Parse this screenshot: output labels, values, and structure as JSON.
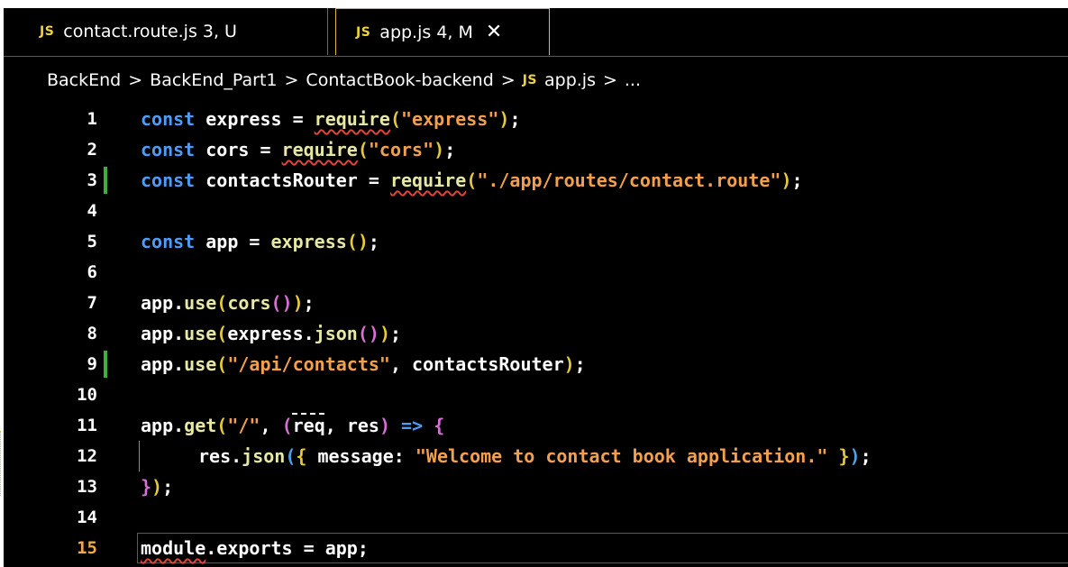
{
  "tabs": [
    {
      "badge": "JS",
      "label": "contact.route.js 3, U",
      "active": false
    },
    {
      "badge": "JS",
      "label": "app.js 4, M",
      "active": true,
      "close_icon": "close-icon"
    }
  ],
  "breadcrumb": {
    "parts": [
      "BackEnd",
      "BackEnd_Part1",
      "ContactBook-backend"
    ],
    "separator": ">",
    "file_badge": "JS",
    "file": "app.js",
    "trail": "..."
  },
  "lines": [
    "1",
    "2",
    "3",
    "4",
    "5",
    "6",
    "7",
    "8",
    "9",
    "10",
    "11",
    "12",
    "13",
    "14",
    "15"
  ],
  "code": {
    "l1": {
      "kw": "const",
      "a": " express = ",
      "req": "require",
      "p1": "(",
      "s": "\"express\"",
      "p2": ")",
      "end": ";"
    },
    "l2": {
      "kw": "const",
      "a": " cors = ",
      "req": "require",
      "p1": "(",
      "s": "\"cors\"",
      "p2": ")",
      "end": ";"
    },
    "l3": {
      "kw": "const",
      "a": " contactsRouter = ",
      "req": "require",
      "p1": "(",
      "s": "\"./app/routes/contact.route\"",
      "p2": ")",
      "end": ";"
    },
    "l5": {
      "kw": "const",
      "a": " app = ",
      "fn": "express",
      "p": "()",
      "end": ";"
    },
    "l7": {
      "a": "app.",
      "fn": "use",
      "p1": "(",
      "b": "cors",
      "p2": "()",
      "p3": ")",
      "end": ";"
    },
    "l8": {
      "a": "app.",
      "fn": "use",
      "p1": "(",
      "b": "express.",
      "c": "json",
      "p2": "()",
      "p3": ")",
      "end": ";"
    },
    "l9": {
      "a": "app.",
      "fn": "use",
      "p1": "(",
      "s": "\"/api/contacts\"",
      "b": ", contactsRouter",
      "p2": ")",
      "end": ";"
    },
    "l11": {
      "a": "app.",
      "fn": "get",
      "p1": "(",
      "s": "\"/\"",
      "b": ", ",
      "p2": "(",
      "c": "req",
      "d": ", res",
      "p3": ")",
      "e": " ",
      "arrow": "=>",
      "f": " ",
      "p4": "{"
    },
    "l12": {
      "a": "res.",
      "fn": "json",
      "p1": "(",
      "p2": "{",
      "b": " message: ",
      "s": "\"Welcome to contact book application.\"",
      "c": " ",
      "p3": "}",
      "p4": ")",
      "end": ";"
    },
    "l13": {
      "p1": "}",
      "p2": ")",
      "end": ";"
    },
    "l15": {
      "a": "module",
      "b": ".exports = app;"
    }
  },
  "colors": {
    "keyword": "#4e9cf5",
    "string": "#f2a04e",
    "bracket1": "#e5c93a",
    "bracket2": "#d96fd6",
    "bracket3": "#4aa3e8",
    "git_modified": "#3fae3a",
    "active_line_number": "#f0a848",
    "active_tab_border": "#e3b341"
  }
}
